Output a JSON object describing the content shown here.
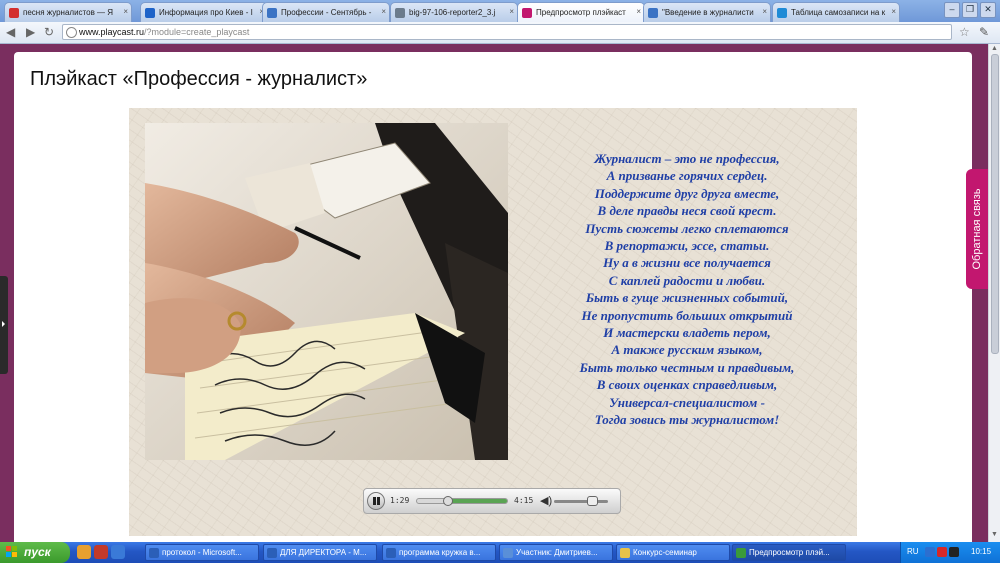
{
  "browser": {
    "tabs": [
      {
        "label": "песня журналистов — Я",
        "icon": "yandex-icon",
        "color": "#d32f2f",
        "active": false
      },
      {
        "label": "Информация про Киев - І",
        "icon": "info-icon",
        "color": "#1e63c8",
        "active": false
      },
      {
        "label": "Профессии - Сентябрь -",
        "icon": "document-icon",
        "color": "#3b73c4",
        "active": false
      },
      {
        "label": "big-97-106-reporter2_3.j",
        "icon": "globe-icon",
        "color": "#6b7b8c",
        "active": false
      },
      {
        "label": "Предпросмотр плэйкаст",
        "icon": "playcast-icon",
        "color": "#c2176f",
        "active": true
      },
      {
        "label": "\"Введение в журналисти",
        "icon": "document-icon",
        "color": "#3b73c4",
        "active": false
      },
      {
        "label": "Таблица самозаписи на к",
        "icon": "edge-icon",
        "color": "#1f8bd6",
        "active": false
      }
    ],
    "address": {
      "host": "www.playcast.ru",
      "path": "/?module=create_playcast"
    }
  },
  "page": {
    "title": "Плэйкаст «Профессия - журналист»",
    "poem": [
      "Журналист – это не профессия,",
      "А призванье горячих сердец.",
      "Поддержите друг друга вместе,",
      "В деле правды неся свой крест.",
      "Пусть сюжеты легко сплетаются",
      "В репортажи, эссе, статьи.",
      "Ну а в жизни все получается",
      "С каплей радости и любви.",
      "Быть в гуще жизненных событий,",
      "Не пропустить больших открытий",
      "И мастерски владеть пером,",
      "А также русским языком,",
      "Быть только честным и правдивым,",
      "В своих оценках справедливым,",
      "Универсал-специалистом -",
      "Тогда зовись ты журналистом!"
    ],
    "player": {
      "elapsed": "1:29",
      "total": "4:15",
      "progress": 0.35,
      "volume": 0.7
    },
    "feedback_label": "Обратная связь"
  },
  "taskbar": {
    "start_label": "пуск",
    "tasks": [
      {
        "label": "протокол - Microsoft...",
        "color": "#2b5fb8",
        "active": false
      },
      {
        "label": "ДЛЯ ДИРЕКТОРА - M...",
        "color": "#2b5fb8",
        "active": false
      },
      {
        "label": "программа кружка в...",
        "color": "#2b5fb8",
        "active": false
      },
      {
        "label": "Участник: Дмитриев...",
        "color": "#5a8fd8",
        "active": false
      },
      {
        "label": "Конкурс-семинар",
        "color": "#e8c24a",
        "active": false
      },
      {
        "label": "Предпросмотр плэй...",
        "color": "#3a9a3a",
        "active": true
      }
    ],
    "lang": "RU",
    "clock": "10:15"
  }
}
